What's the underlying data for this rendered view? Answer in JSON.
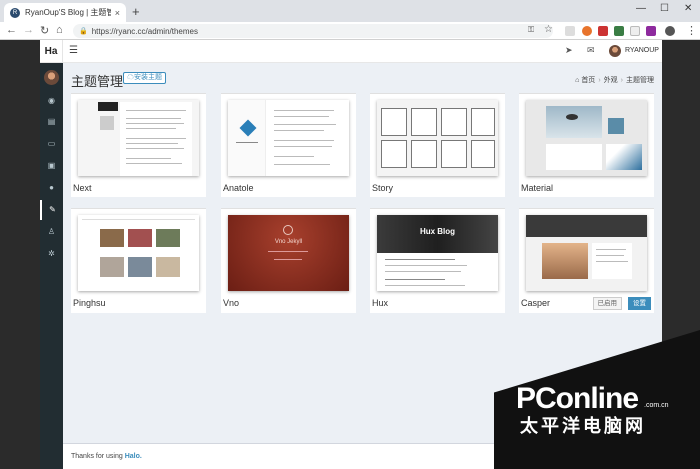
{
  "browser": {
    "tab_title": "RyanOup'S Blog | 主题管理",
    "tab_close": "×",
    "new_tab": "+",
    "url": "https://ryanc.cc/admin/themes",
    "window_min": "—",
    "window_max": "☐",
    "window_close": "✕"
  },
  "app": {
    "brand": "Ha",
    "user": "RYANOUP",
    "page_title": "主题管理",
    "install_button": "安装主题",
    "breadcrumb": [
      "首页",
      "外观",
      "主题管理"
    ]
  },
  "themes": [
    {
      "name": "Next"
    },
    {
      "name": "Anatole"
    },
    {
      "name": "Story"
    },
    {
      "name": "Material"
    },
    {
      "name": "Pinghsu"
    },
    {
      "name": "Vno"
    },
    {
      "name": "Hux"
    },
    {
      "name": "Casper",
      "used_label": "已启用",
      "set_label": "设置"
    }
  ],
  "thumbnails": {
    "hux_title": "Hux Blog",
    "vno_title": "Vno Jekyll"
  },
  "footer": {
    "prefix": "Thanks for using ",
    "link": "Halo."
  },
  "watermark": {
    "text": "PConline",
    "sub": "太平洋电脑网",
    "com": ".com.cn"
  },
  "colors": {
    "accent": "#3c8dbc",
    "sidebar": "#222d32"
  }
}
